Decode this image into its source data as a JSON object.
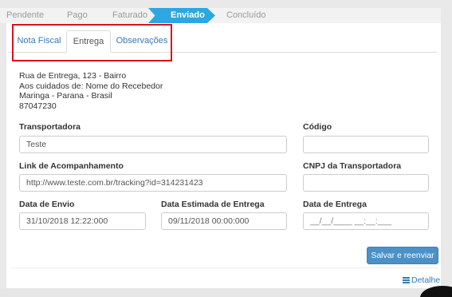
{
  "steps": [
    "Pendente",
    "Pago",
    "Faturado",
    "Enviado",
    "Concluído"
  ],
  "tabs": [
    "Nota Fiscal",
    "Entrega",
    "Observações"
  ],
  "address": [
    "Rua de Entrega, 123 - Bairro",
    "Aos cuidados de: Nome do Recebedor",
    "Maringa - Parana - Brasil",
    "87047230"
  ],
  "form": {
    "transportadora_label": "Transportadora",
    "transportadora_value": "Teste",
    "codigo_label": "Código",
    "codigo_value": "",
    "link_label": "Link de Acompanhamento",
    "link_value": "http://www.teste.com.br/tracking?id=314231423",
    "cnpj_label": "CNPJ da Transportadora",
    "cnpj_value": "",
    "envio_label": "Data de Envio",
    "envio_value": "31/10/2018 12:22:000",
    "estimada_label": "Data Estimada de Entrega",
    "estimada_value": "09/11/2018 00:00:000",
    "entrega_label": "Data de Entrega",
    "entrega_value": "__/__/____ __:__:___"
  },
  "actions": {
    "save_label": "Salvar e reenviar",
    "detail_label": "Detalhe"
  }
}
